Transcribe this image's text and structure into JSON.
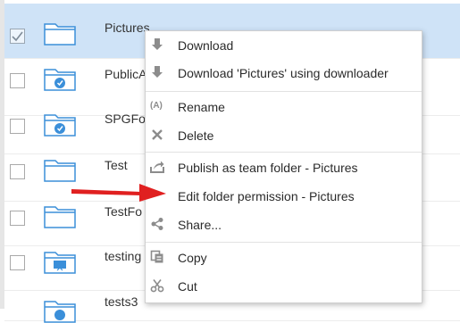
{
  "file_list": {
    "rows": [
      {
        "name": "Pictures",
        "icon": "folder-icon",
        "selected": true,
        "checked": true
      },
      {
        "name": "PublicA",
        "icon": "shared-folder-icon",
        "selected": false,
        "checked": false
      },
      {
        "name": "SPGFo",
        "icon": "shared-folder-icon",
        "selected": false,
        "checked": false
      },
      {
        "name": "Test",
        "icon": "folder-icon",
        "selected": false,
        "checked": false
      },
      {
        "name": "TestFo",
        "icon": "folder-icon",
        "selected": false,
        "checked": false
      },
      {
        "name": "testing",
        "icon": "presentation-folder-icon",
        "selected": false,
        "checked": false
      },
      {
        "name": "tests3",
        "icon": "shared-folder-icon",
        "selected": false,
        "checked": false
      }
    ]
  },
  "context_menu": {
    "items": [
      {
        "label": "Download",
        "icon": "download-icon"
      },
      {
        "label": "Download 'Pictures' using downloader",
        "icon": "download-icon"
      },
      {
        "label": "Rename",
        "icon": "rename-icon"
      },
      {
        "label": "Delete",
        "icon": "close-icon"
      },
      {
        "label": "Publish as team folder - Pictures",
        "icon": "publish-icon"
      },
      {
        "label": "Edit folder permission - Pictures",
        "icon": "permission-icon"
      },
      {
        "label": "Share...",
        "icon": "share-icon"
      },
      {
        "label": "Copy",
        "icon": "copy-icon"
      },
      {
        "label": "Cut",
        "icon": "scissors-icon"
      }
    ],
    "rename_glyph": "(A)"
  },
  "colors": {
    "selected_row": "#cfe3f7",
    "folder_stroke": "#3b8fd9",
    "menu_icon": "#8c8c8c",
    "annotation_arrow": "#e02020"
  }
}
